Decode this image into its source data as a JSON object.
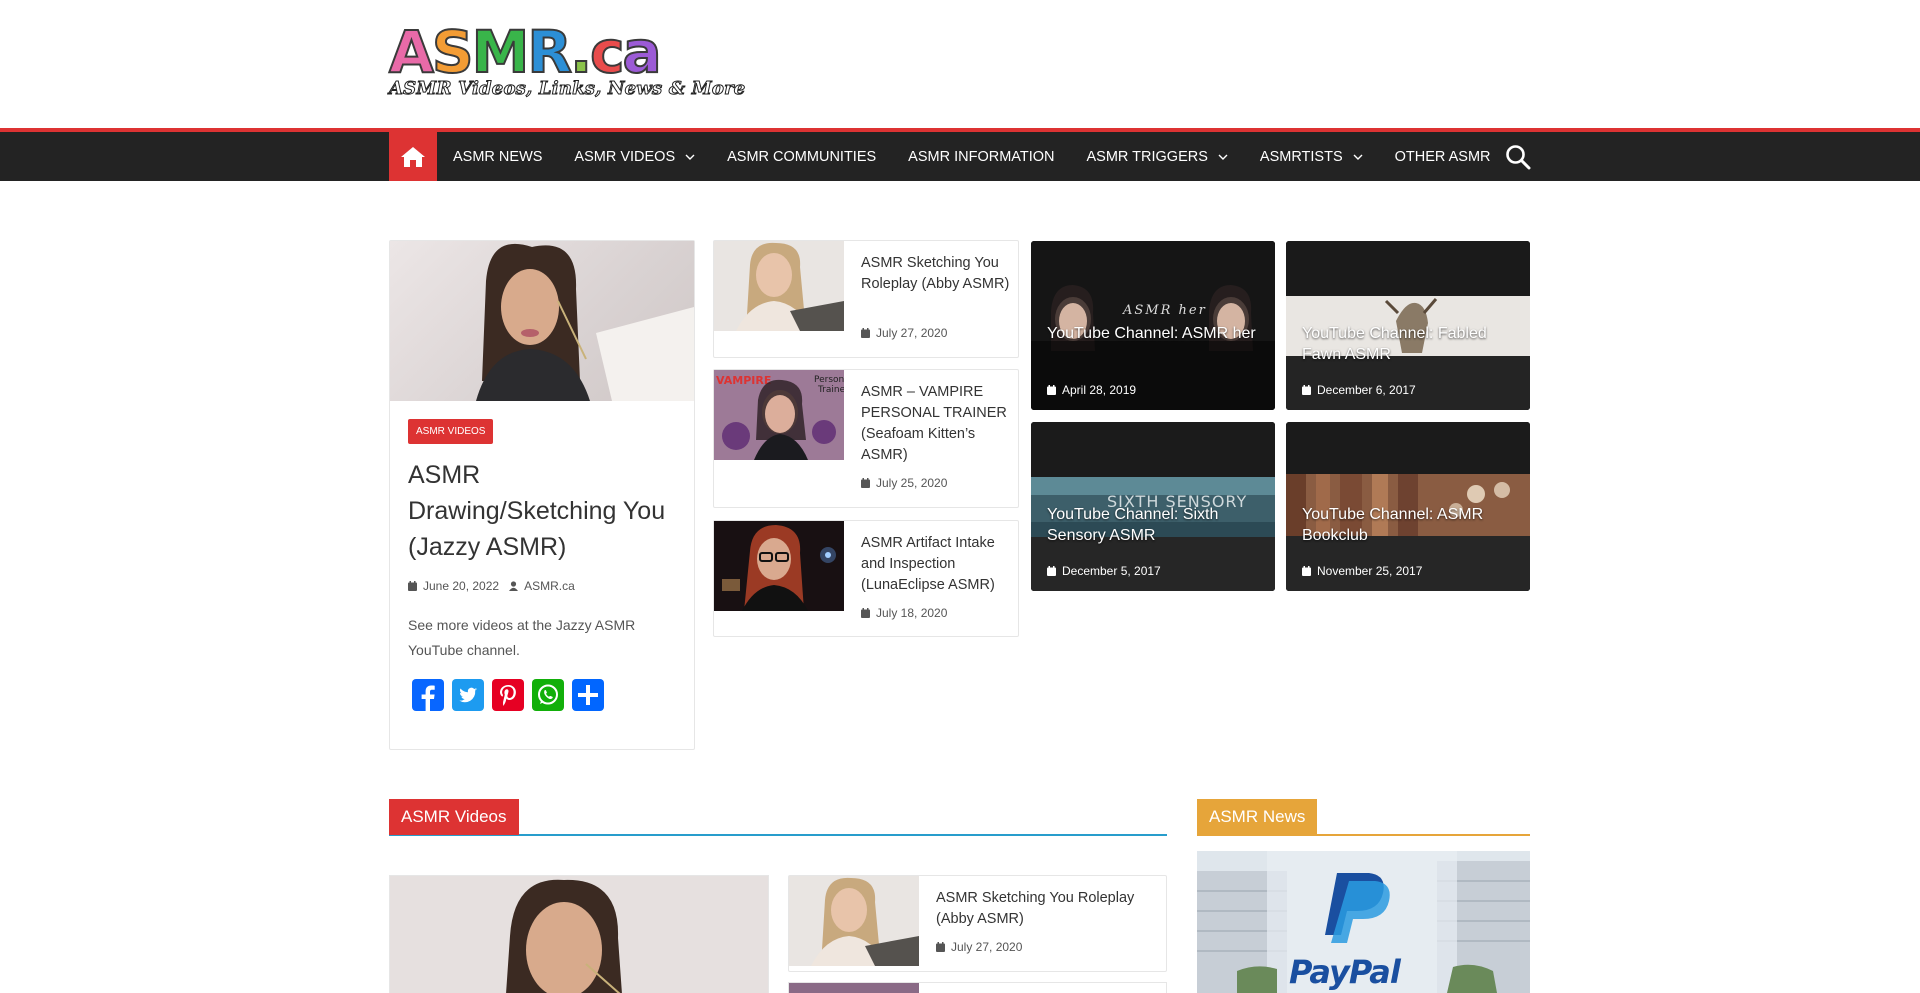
{
  "site": {
    "logo_text": "ASMR.ca",
    "tagline": "ASMR Videos, Links, News & More"
  },
  "nav": {
    "items": [
      {
        "label": "ASMR NEWS",
        "dropdown": false
      },
      {
        "label": "ASMR VIDEOS",
        "dropdown": true
      },
      {
        "label": "ASMR COMMUNITIES",
        "dropdown": false
      },
      {
        "label": "ASMR INFORMATION",
        "dropdown": false
      },
      {
        "label": "ASMR TRIGGERS",
        "dropdown": true
      },
      {
        "label": "ASMRTISTS",
        "dropdown": true
      },
      {
        "label": "OTHER ASMR",
        "dropdown": false
      }
    ]
  },
  "featured": {
    "category": "ASMR VIDEOS",
    "title": "ASMR Drawing/Sketching You (Jazzy ASMR)",
    "date": "June 20, 2022",
    "author": "ASMR.ca",
    "excerpt": "See more videos at the Jazzy ASMR YouTube channel."
  },
  "small_posts": [
    {
      "title": "ASMR Sketching You Roleplay (Abby ASMR)",
      "date": "July 27, 2020"
    },
    {
      "title": "ASMR – VAMPIRE PERSONAL TRAINER (Seafoam Kitten’s ASMR)",
      "date": "July 25, 2020"
    },
    {
      "title": "ASMR Artifact Intake and Inspection (LunaEclipse ASMR)",
      "date": "July 18, 2020"
    }
  ],
  "tiles": [
    {
      "title": "YouTube Channel: ASMR her",
      "date": "April 28, 2019",
      "overlay_text": "ASMR her"
    },
    {
      "title": "YouTube Channel: Fabled Fawn ASMR",
      "date": "December 6, 2017"
    },
    {
      "title": "YouTube Channel: Sixth Sensory ASMR",
      "date": "December 5, 2017",
      "overlay_text": "SIXTH SENSORY"
    },
    {
      "title": "YouTube Channel: ASMR Bookclub",
      "date": "November 25, 2017"
    }
  ],
  "sections": {
    "videos_label": "ASMR Videos",
    "news_label": "ASMR News",
    "videos_post": {
      "title": "ASMR Sketching You Roleplay (Abby ASMR)",
      "date": "July 27, 2020"
    },
    "news_image_text": "PayPal"
  },
  "colors": {
    "accent_red": "#dd3333",
    "nav_bg": "#232323",
    "section_line": "#289dcc",
    "news_orange": "#e6a53a"
  }
}
